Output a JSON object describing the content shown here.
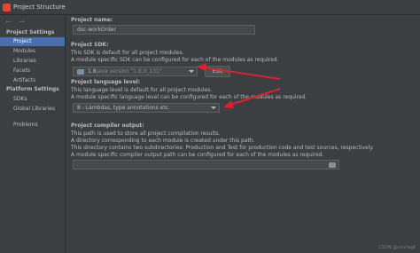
{
  "window": {
    "title": "Project Structure"
  },
  "nav": {
    "arrows": "← →",
    "project_settings_header": "Project Settings",
    "project_settings_items": [
      "Project",
      "Modules",
      "Libraries",
      "Facets",
      "Artifacts"
    ],
    "platform_settings_header": "Platform Settings",
    "platform_settings_items": [
      "SDKs",
      "Global Libraries"
    ],
    "problems": "Problems",
    "selected": "Project"
  },
  "project": {
    "name_label": "Project name:",
    "name_value": "dsc-workOrder",
    "sdk_label": "Project SDK:",
    "sdk_desc1": "This SDK is default for all project modules.",
    "sdk_desc2": "A module specific SDK can be configured for each of the modules as required.",
    "sdk_name": "1.8",
    "sdk_version": "java version \"1.8.0_131\"",
    "edit_button": "Edit",
    "lang_label": "Project language level:",
    "lang_desc1": "This language level is default for all project modules.",
    "lang_desc2": "A module specific language level can be configured for each of the modules as required.",
    "lang_value": "8 - Lambdas, type annotations etc.",
    "output_label": "Project compiler output:",
    "output_desc1": "This path is used to store all project compilation results.",
    "output_desc2": "A directory corresponding to each module is created under this path.",
    "output_desc3": "This directory contains two subdirectories: Production and Test for production code and test sources, respectively.",
    "output_desc4": "A module specific compiler output path can be configured for each of the modules as required.",
    "output_value": ""
  },
  "watermark": "CSDN @cnnriagt",
  "colors": {
    "accent": "#4b6eaf",
    "annotation_arrow": "#e0202a",
    "background": "#3c3f41"
  }
}
